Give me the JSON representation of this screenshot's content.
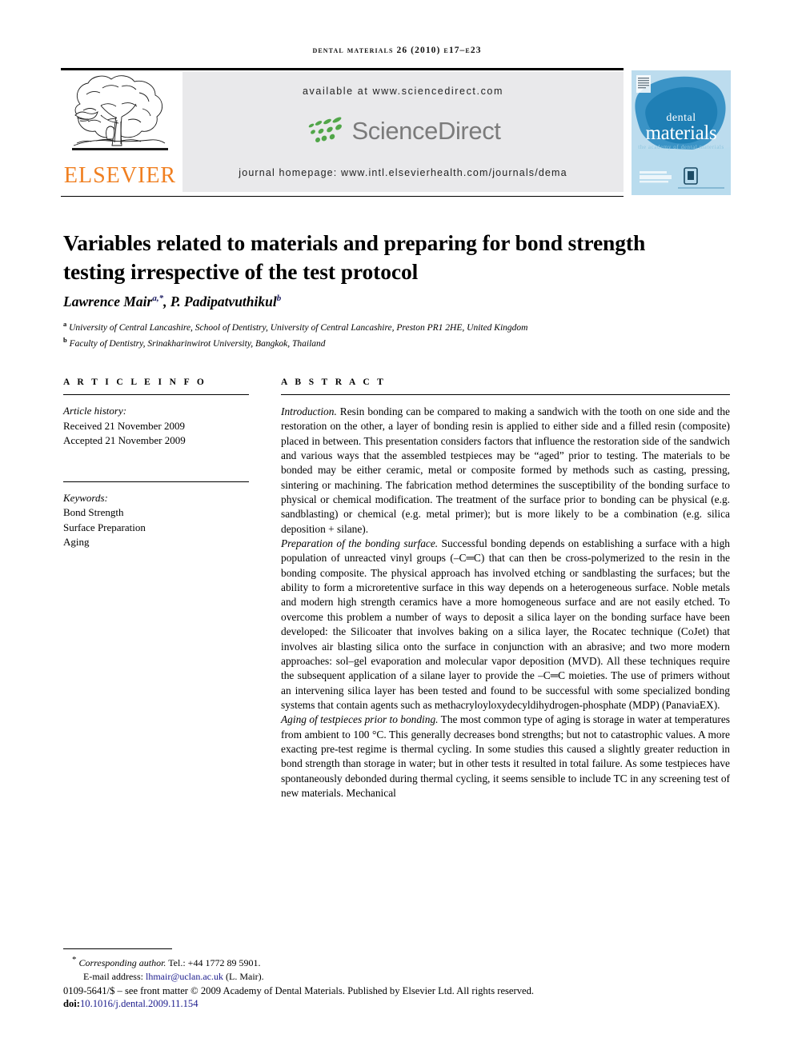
{
  "running_head": "Dental Materials 26 (2010) e17–e23",
  "masthead": {
    "publisher": "ELSEVIER",
    "available_at": "available at www.sciencedirect.com",
    "sciencedirect_wordmark": "ScienceDirect",
    "journal_homepage": "journal homepage: www.intl.elsevierhealth.com/journals/dema",
    "cover": {
      "line1": "dental",
      "line2": "materials",
      "line3": "the academy of dental materials"
    },
    "colors": {
      "elsevier_orange": "#F07F20",
      "sciencedirect_green": "#51A649",
      "sciencedirect_gray": "#7b7b7b",
      "band_gray": "#e9e9eb",
      "cover_blue": "#1f7fb5",
      "link_navy": "#1b1b8c"
    }
  },
  "article": {
    "title": "Variables related to materials and preparing for bond strength testing irrespective of the test protocol",
    "authors_html": "Lawrence Mair<sup>a,*</sup>, P. Padipatvuthikul<sup>b</sup>",
    "affiliations": [
      {
        "marker": "a",
        "text": "University of Central Lancashire, School of Dentistry, University of Central Lancashire, Preston PR1 2HE, United Kingdom"
      },
      {
        "marker": "b",
        "text": "Faculty of Dentistry, Srinakharinwirot University, Bangkok, Thailand"
      }
    ]
  },
  "article_info": {
    "heading": "A R T I C L E    I N F O",
    "history_label": "Article history:",
    "history": [
      "Received 21 November 2009",
      "Accepted 21 November 2009"
    ],
    "keywords_label": "Keywords:",
    "keywords": [
      "Bond Strength",
      "Surface Preparation",
      "Aging"
    ]
  },
  "abstract": {
    "heading": "A B S T R A C T",
    "paragraphs": [
      {
        "lead": "Introduction.",
        "text": " Resin bonding can be compared to making a sandwich with the tooth on one side and the restoration on the other, a layer of bonding resin is applied to either side and a filled resin (composite) placed in between. This presentation considers factors that influence the restoration side of the sandwich and various ways that the assembled testpieces may be “aged” prior to testing. The materials to be bonded may be either ceramic, metal or composite formed by methods such as casting, pressing, sintering or machining. The fabrication method determines the susceptibility of the bonding surface to physical or chemical modification. The treatment of the surface prior to bonding can be physical (e.g. sandblasting) or chemical (e.g. metal primer); but is more likely to be a combination (e.g. silica deposition + silane)."
      },
      {
        "lead": "Preparation of the bonding surface.",
        "text": " Successful bonding depends on establishing a surface with a high population of unreacted vinyl groups (–C═C) that can then be cross-polymerized to the resin in the bonding composite. The physical approach has involved etching or sandblasting the surfaces; but the ability to form a microretentive surface in this way depends on a heterogeneous surface. Noble metals and modern high strength ceramics have a more homogeneous surface and are not easily etched. To overcome this problem a number of ways to deposit a silica layer on the bonding surface have been developed: the Silicoater that involves baking on a silica layer, the Rocatec technique (CoJet) that involves air blasting silica onto the surface in conjunction with an abrasive; and two more modern approaches: sol–gel evaporation and molecular vapor deposition (MVD). All these techniques require the subsequent application of a silane layer to provide the –C═C moieties. The use of primers without an intervening silica layer has been tested and found to be successful with some specialized bonding systems that contain agents such as methacryloyloxydecyldihydrogen-phosphate (MDP) (PanaviaEX)."
      },
      {
        "lead": "Aging of testpieces prior to bonding.",
        "text": " The most common type of aging is storage in water at temperatures from ambient to 100 °C. This generally decreases bond strengths; but not to catastrophic values. A more exacting pre-test regime is thermal cycling. In some studies this caused a slightly greater reduction in bond strength than storage in water; but in other tests it resulted in total failure. As some testpieces have spontaneously debonded during thermal cycling, it seems sensible to include TC in any screening test of new materials. Mechanical"
      }
    ]
  },
  "footer": {
    "corresponding_label": "Corresponding author.",
    "corresponding_tel": " Tel.: +44 1772 89 5901.",
    "email_label": "E-mail address:",
    "email": "lhmair@uclan.ac.uk",
    "email_suffix": " (L. Mair).",
    "copyright": "0109-5641/$ – see front matter © 2009 Academy of Dental Materials. Published by Elsevier Ltd. All rights reserved.",
    "doi_label": "doi:",
    "doi_value": "10.1016/j.dental.2009.11.154"
  }
}
